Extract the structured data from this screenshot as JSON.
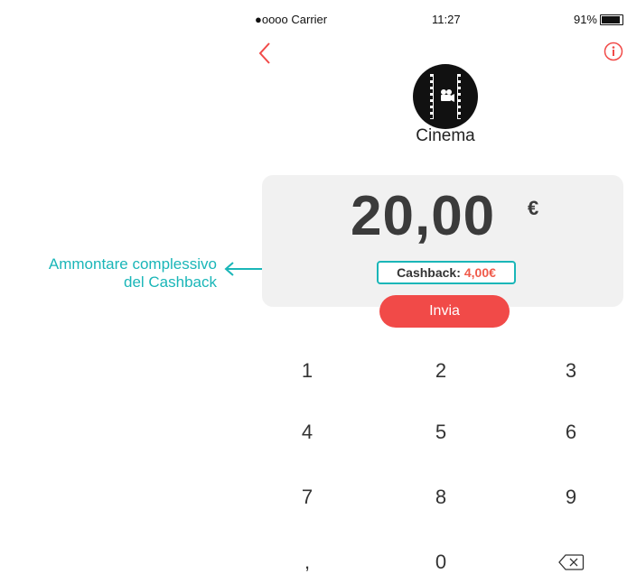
{
  "annotation": {
    "line1": "Ammontare complessivo",
    "line2": "del Cashback",
    "color": "#1ab6b8"
  },
  "status_bar": {
    "carrier": "●oooo Carrier",
    "time": "11:27",
    "battery": "91%"
  },
  "navigation": {
    "back_icon": "chevron-left-icon",
    "info_icon": "info-icon"
  },
  "category": {
    "label": "Cinema",
    "icon": "film-camera-icon"
  },
  "amount": {
    "value": "20,00",
    "currency": "€"
  },
  "cashback": {
    "label": "Cashback:",
    "value": "4,00€"
  },
  "send_button": {
    "label": "Invia"
  },
  "keypad": {
    "keys": [
      "1",
      "2",
      "3",
      "4",
      "5",
      "6",
      "7",
      "8",
      "9",
      ",",
      "0"
    ],
    "backspace_icon": "backspace-icon"
  },
  "colors": {
    "accent": "#f14a48",
    "cashback_accent": "#f05a4a",
    "highlight": "#1ab6b8"
  }
}
